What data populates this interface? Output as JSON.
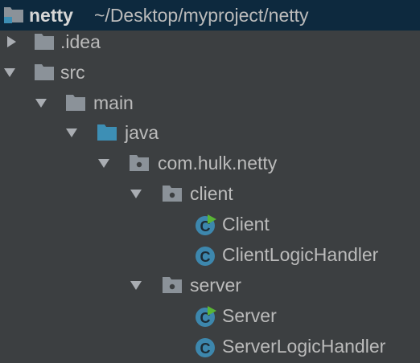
{
  "project": {
    "name": "netty",
    "path": "~/Desktop/myproject/netty"
  },
  "tree": {
    "idea": ".idea",
    "src": "src",
    "main": "main",
    "java": "java",
    "package": "com.hulk.netty",
    "client_pkg": "client",
    "client_class": "Client",
    "client_handler": "ClientLogicHandler",
    "server_pkg": "server",
    "server_class": "Server",
    "server_handler": "ServerLogicHandler"
  },
  "colors": {
    "background": "#3c3f41",
    "selection": "#0d293e",
    "folder": "#8b9299",
    "source_folder": "#3d8fb5",
    "class_icon": "#3d87ad",
    "run_badge": "#5ab536"
  },
  "icons": {
    "arrow_collapsed": "triangle-right",
    "arrow_expanded": "triangle-down",
    "folder": "folder",
    "source_folder": "blue-folder",
    "package": "package-folder",
    "class": "class-c",
    "runnable": "run-triangle-badge"
  }
}
